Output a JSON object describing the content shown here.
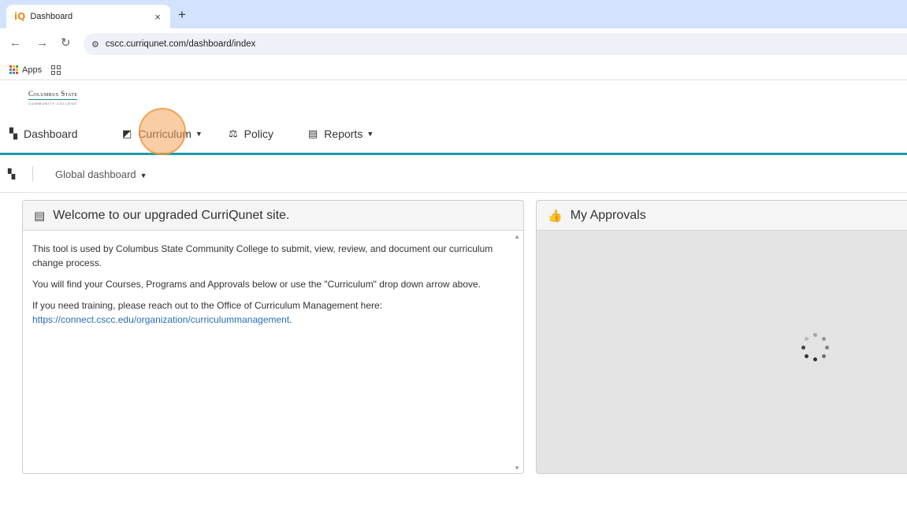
{
  "browser": {
    "tab_title": "Dashboard",
    "tab_favicon": "iQ",
    "tab_close": "×",
    "new_tab": "+",
    "url": "cscc.curriqunet.com/dashboard/index",
    "bookmarks": {
      "apps_label": "Apps"
    }
  },
  "brand": {
    "name": "Columbus State",
    "tagline": "COMMUNITY COLLEGE"
  },
  "nav": {
    "items": [
      {
        "label": "Dashboard",
        "icon": "dashboard-icon"
      },
      {
        "label": "Curriculum",
        "icon": "curriculum-icon",
        "dropdown": true
      },
      {
        "label": "Policy",
        "icon": "policy-icon"
      },
      {
        "label": "Reports",
        "icon": "reports-icon",
        "dropdown": true
      }
    ]
  },
  "subheader": {
    "dashboard_select": "Global dashboard"
  },
  "welcome_panel": {
    "title": "Welcome to our upgraded CurriQunet site.",
    "para1": "This tool is used by Columbus State Community College to submit, view, review, and document our curriculum change process.",
    "para2": "You will find your Courses, Programs and Approvals below or use the \"Curriculum\" drop down arrow above.",
    "para3_prefix": "If you need training, please reach out to the Office of Curriculum Management here: ",
    "para3_link": "https://connect.cscc.edu/organization/curriculummanagement",
    "para3_suffix": "."
  },
  "approvals_panel": {
    "title": "My Approvals",
    "state": "loading"
  },
  "colors": {
    "accent": "#1f9aa8",
    "link": "#2a6fb5",
    "tabstrip": "#d3e3fd",
    "click_highlight": "#f5a65a"
  }
}
